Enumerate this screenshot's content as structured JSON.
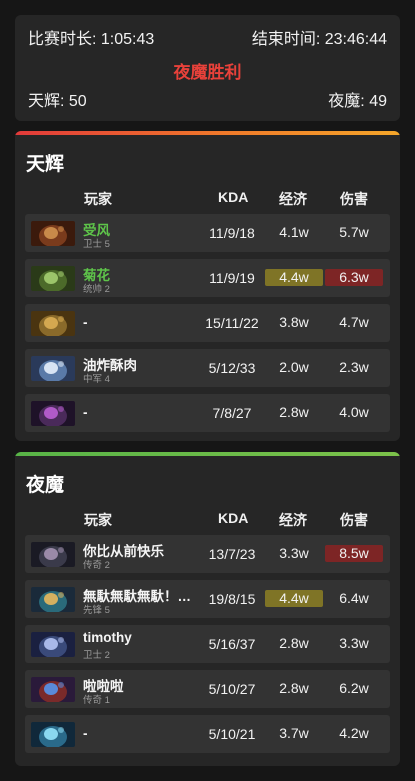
{
  "summary": {
    "duration_label": "比赛时长: 1:05:43",
    "end_time_label": "结束时间: 23:46:44",
    "winner_text": "夜魔胜利",
    "radiant_score": "天辉: 50",
    "dire_score": "夜魔: 49",
    "winner_color": "#e8413a"
  },
  "columns": {
    "player": "玩家",
    "kda": "KDA",
    "economy": "经济",
    "damage": "伤害"
  },
  "radiant": {
    "title": "天辉",
    "accent": "#f07a2a",
    "players": [
      {
        "name": "受风",
        "rank": "卫士 5",
        "kda": "11/9/18",
        "econ": "4.1w",
        "dmg": "5.7w",
        "name_color": "green",
        "avatar": "hero-avatar-icon"
      },
      {
        "name": "菊花",
        "rank": "统帅 2",
        "kda": "11/9/19",
        "econ": "4.4w",
        "dmg": "6.3w",
        "name_color": "green",
        "econ_highlight": "gold",
        "dmg_highlight": "red",
        "avatar": "hero-avatar-icon"
      },
      {
        "name": "-",
        "rank": "",
        "kda": "15/11/22",
        "econ": "3.8w",
        "dmg": "4.7w",
        "avatar": "hero-avatar-icon"
      },
      {
        "name": "油炸酥肉",
        "rank": "中军 4",
        "kda": "5/12/33",
        "econ": "2.0w",
        "dmg": "2.3w",
        "avatar": "hero-avatar-icon"
      },
      {
        "name": "-",
        "rank": "",
        "kda": "7/8/27",
        "econ": "2.8w",
        "dmg": "4.0w",
        "avatar": "hero-avatar-icon"
      }
    ]
  },
  "dire": {
    "title": "夜魔",
    "accent": "#6cbc48",
    "players": [
      {
        "name": "你比从前快乐",
        "rank": "传奇 2",
        "kda": "13/7/23",
        "econ": "3.3w",
        "dmg": "8.5w",
        "dmg_highlight": "red",
        "avatar": "hero-avatar-icon"
      },
      {
        "name": "無馱無馱無馱！…",
        "rank": "先锋 5",
        "kda": "19/8/15",
        "econ": "4.4w",
        "dmg": "6.4w",
        "econ_highlight": "gold",
        "avatar": "hero-avatar-icon"
      },
      {
        "name": "timothy",
        "rank": "卫士 2",
        "kda": "5/16/37",
        "econ": "2.8w",
        "dmg": "3.3w",
        "avatar": "hero-avatar-icon"
      },
      {
        "name": "啦啦啦",
        "rank": "传奇 1",
        "kda": "5/10/27",
        "econ": "2.8w",
        "dmg": "6.2w",
        "avatar": "hero-avatar-icon"
      },
      {
        "name": "-",
        "rank": "",
        "kda": "5/10/21",
        "econ": "3.7w",
        "dmg": "4.2w",
        "avatar": "hero-avatar-icon"
      }
    ]
  }
}
